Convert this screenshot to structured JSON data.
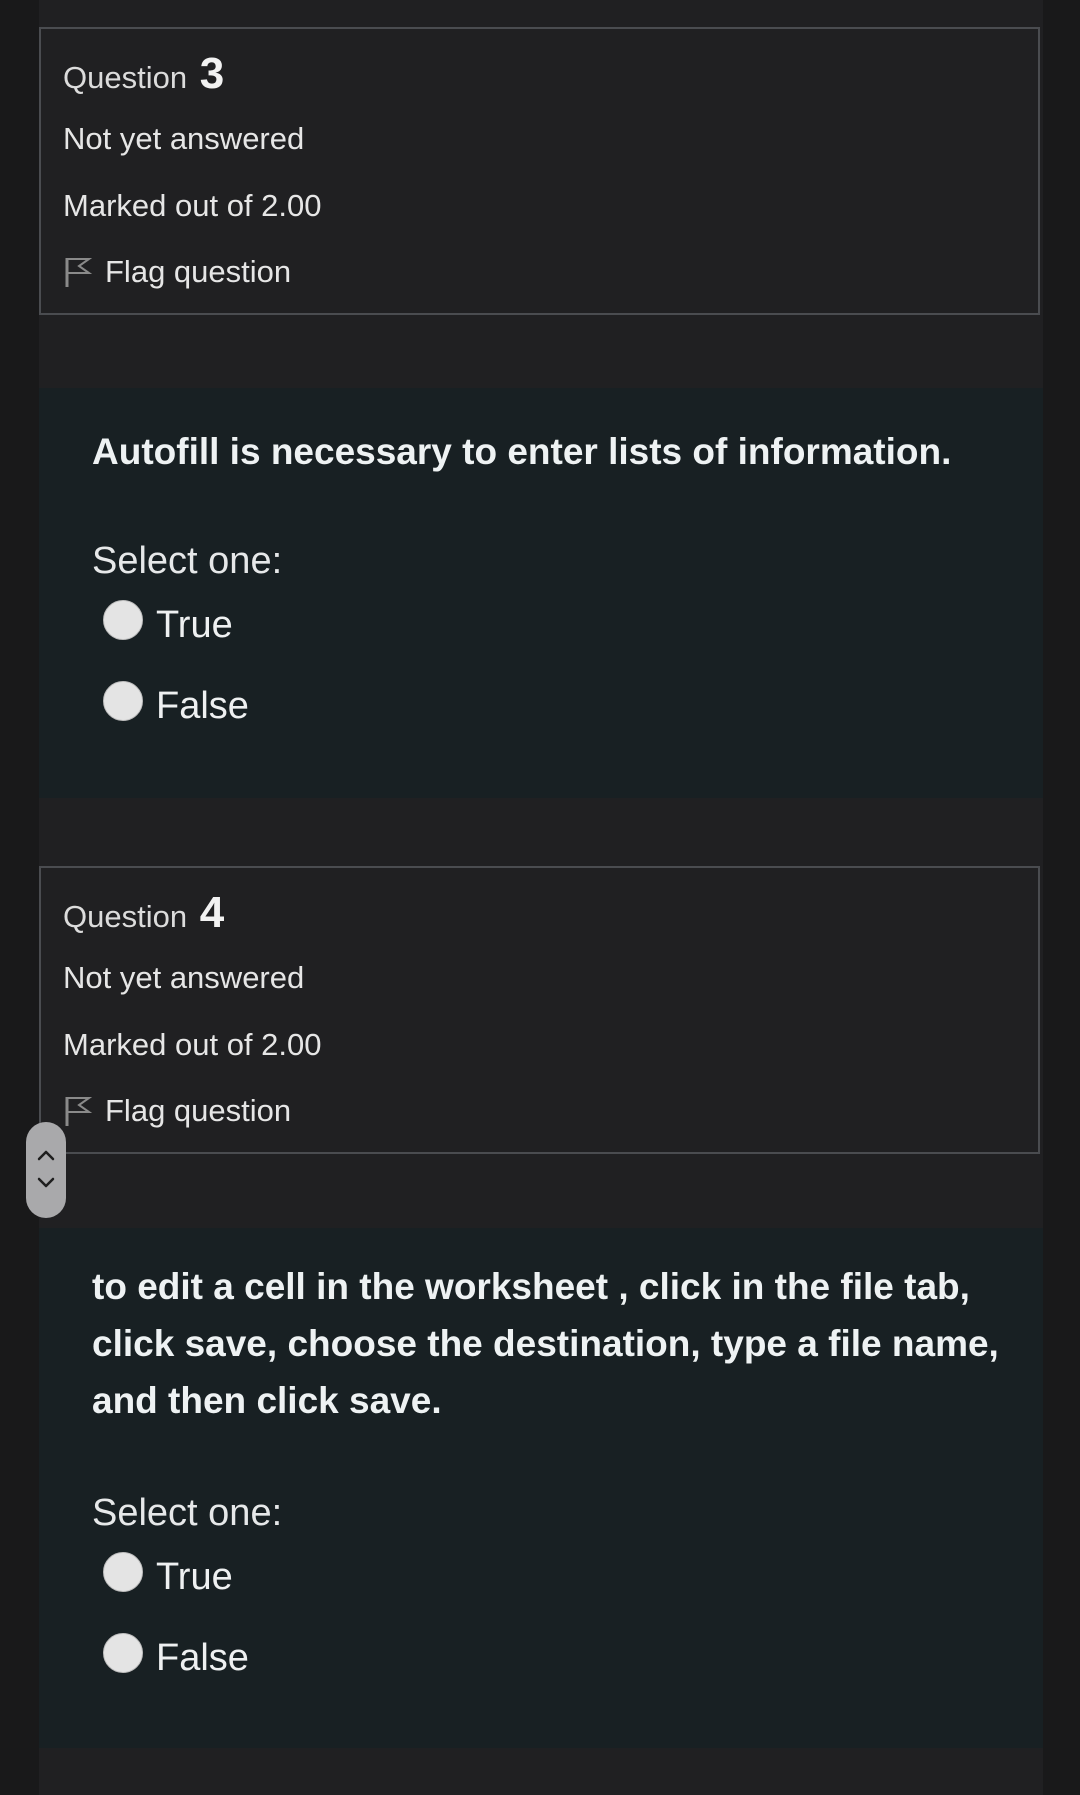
{
  "questions": [
    {
      "label": "Question",
      "number": "3",
      "state": "Not yet answered",
      "grade": "Marked out of 2.00",
      "flag_label": "Flag question",
      "text": "Autofill is necessary to enter  lists of information.",
      "prompt": "Select one:",
      "options": [
        "True",
        "False"
      ]
    },
    {
      "label": "Question",
      "number": "4",
      "state": "Not yet answered",
      "grade": "Marked out of 2.00",
      "flag_label": "Flag question",
      "text": "to edit a cell in the worksheet , click in the file tab, click save, choose the destination, type a file name, and then click save.",
      "prompt": "Select one:",
      "options": [
        "True",
        "False"
      ]
    }
  ],
  "icons": {
    "flag": "flag-icon",
    "radio": "radio-button-unchecked",
    "scroll_up": "chevron-up-icon",
    "scroll_down": "chevron-down-icon"
  },
  "colors": {
    "background": "#19191a",
    "panel": "#202022",
    "content_panel": "#182023",
    "info_border": "#4a4c50",
    "radio_fill": "#e4e4e4"
  }
}
